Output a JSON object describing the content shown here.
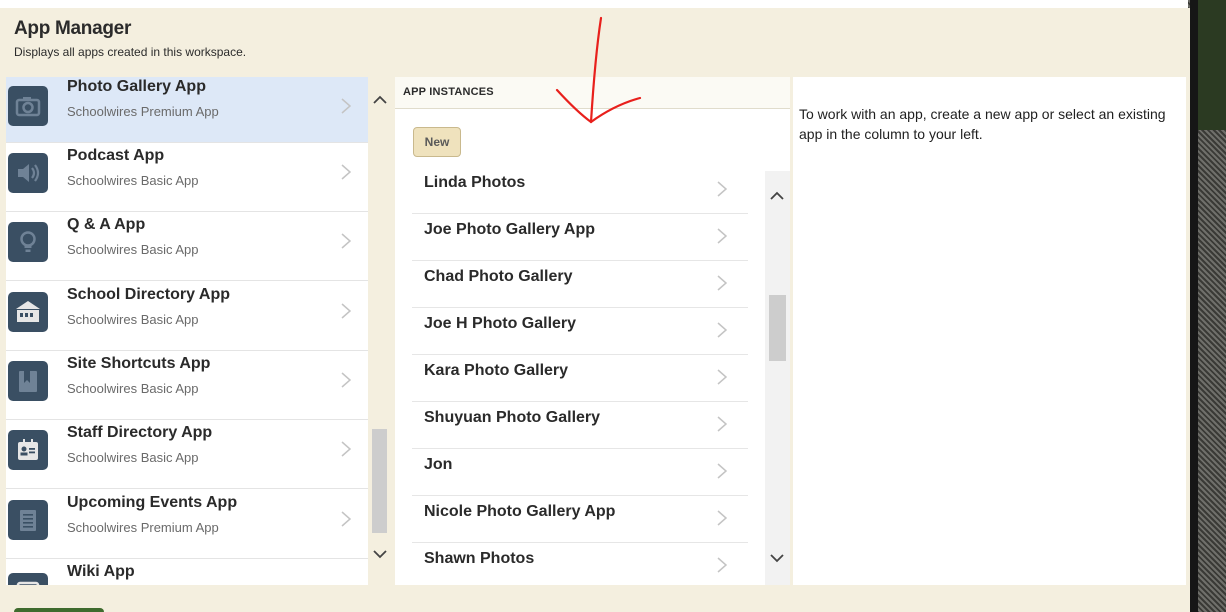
{
  "header": {
    "title": "App Manager",
    "subtitle": "Displays all apps created in this workspace."
  },
  "apps": [
    {
      "name": "Photo Gallery App",
      "type": "Schoolwires Premium App",
      "icon": "camera-icon"
    },
    {
      "name": "Podcast App",
      "type": "Schoolwires Basic App",
      "icon": "speaker-icon"
    },
    {
      "name": "Q & A App",
      "type": "Schoolwires Basic App",
      "icon": "lightbulb-icon"
    },
    {
      "name": "School Directory App",
      "type": "Schoolwires Basic App",
      "icon": "building-icon"
    },
    {
      "name": "Site Shortcuts App",
      "type": "Schoolwires Basic App",
      "icon": "bookmark-icon"
    },
    {
      "name": "Staff Directory App",
      "type": "Schoolwires Basic App",
      "icon": "contact-card-icon"
    },
    {
      "name": "Upcoming Events App",
      "type": "Schoolwires Premium App",
      "icon": "calendar-icon"
    },
    {
      "name": "Wiki App",
      "type": "",
      "icon": "wiki-icon"
    }
  ],
  "instances": {
    "heading": "APP INSTANCES",
    "new_label": "New",
    "items": [
      "Linda Photos",
      "Joe Photo Gallery App",
      "Chad Photo Gallery",
      "Joe H Photo Gallery",
      "Kara Photo Gallery",
      "Shuyuan Photo Gallery",
      "Jon",
      "Nicole Photo Gallery App",
      "Shawn Photos"
    ]
  },
  "details": {
    "hint": "To work with an app, create a new app or select an existing app in the column to your left."
  },
  "colors": {
    "panel": "#f4efdf",
    "selected_row": "#dde8f7",
    "icon_bg": "#3a4f63",
    "new_button": "#efe2bd",
    "annotation": "#e8201c"
  }
}
